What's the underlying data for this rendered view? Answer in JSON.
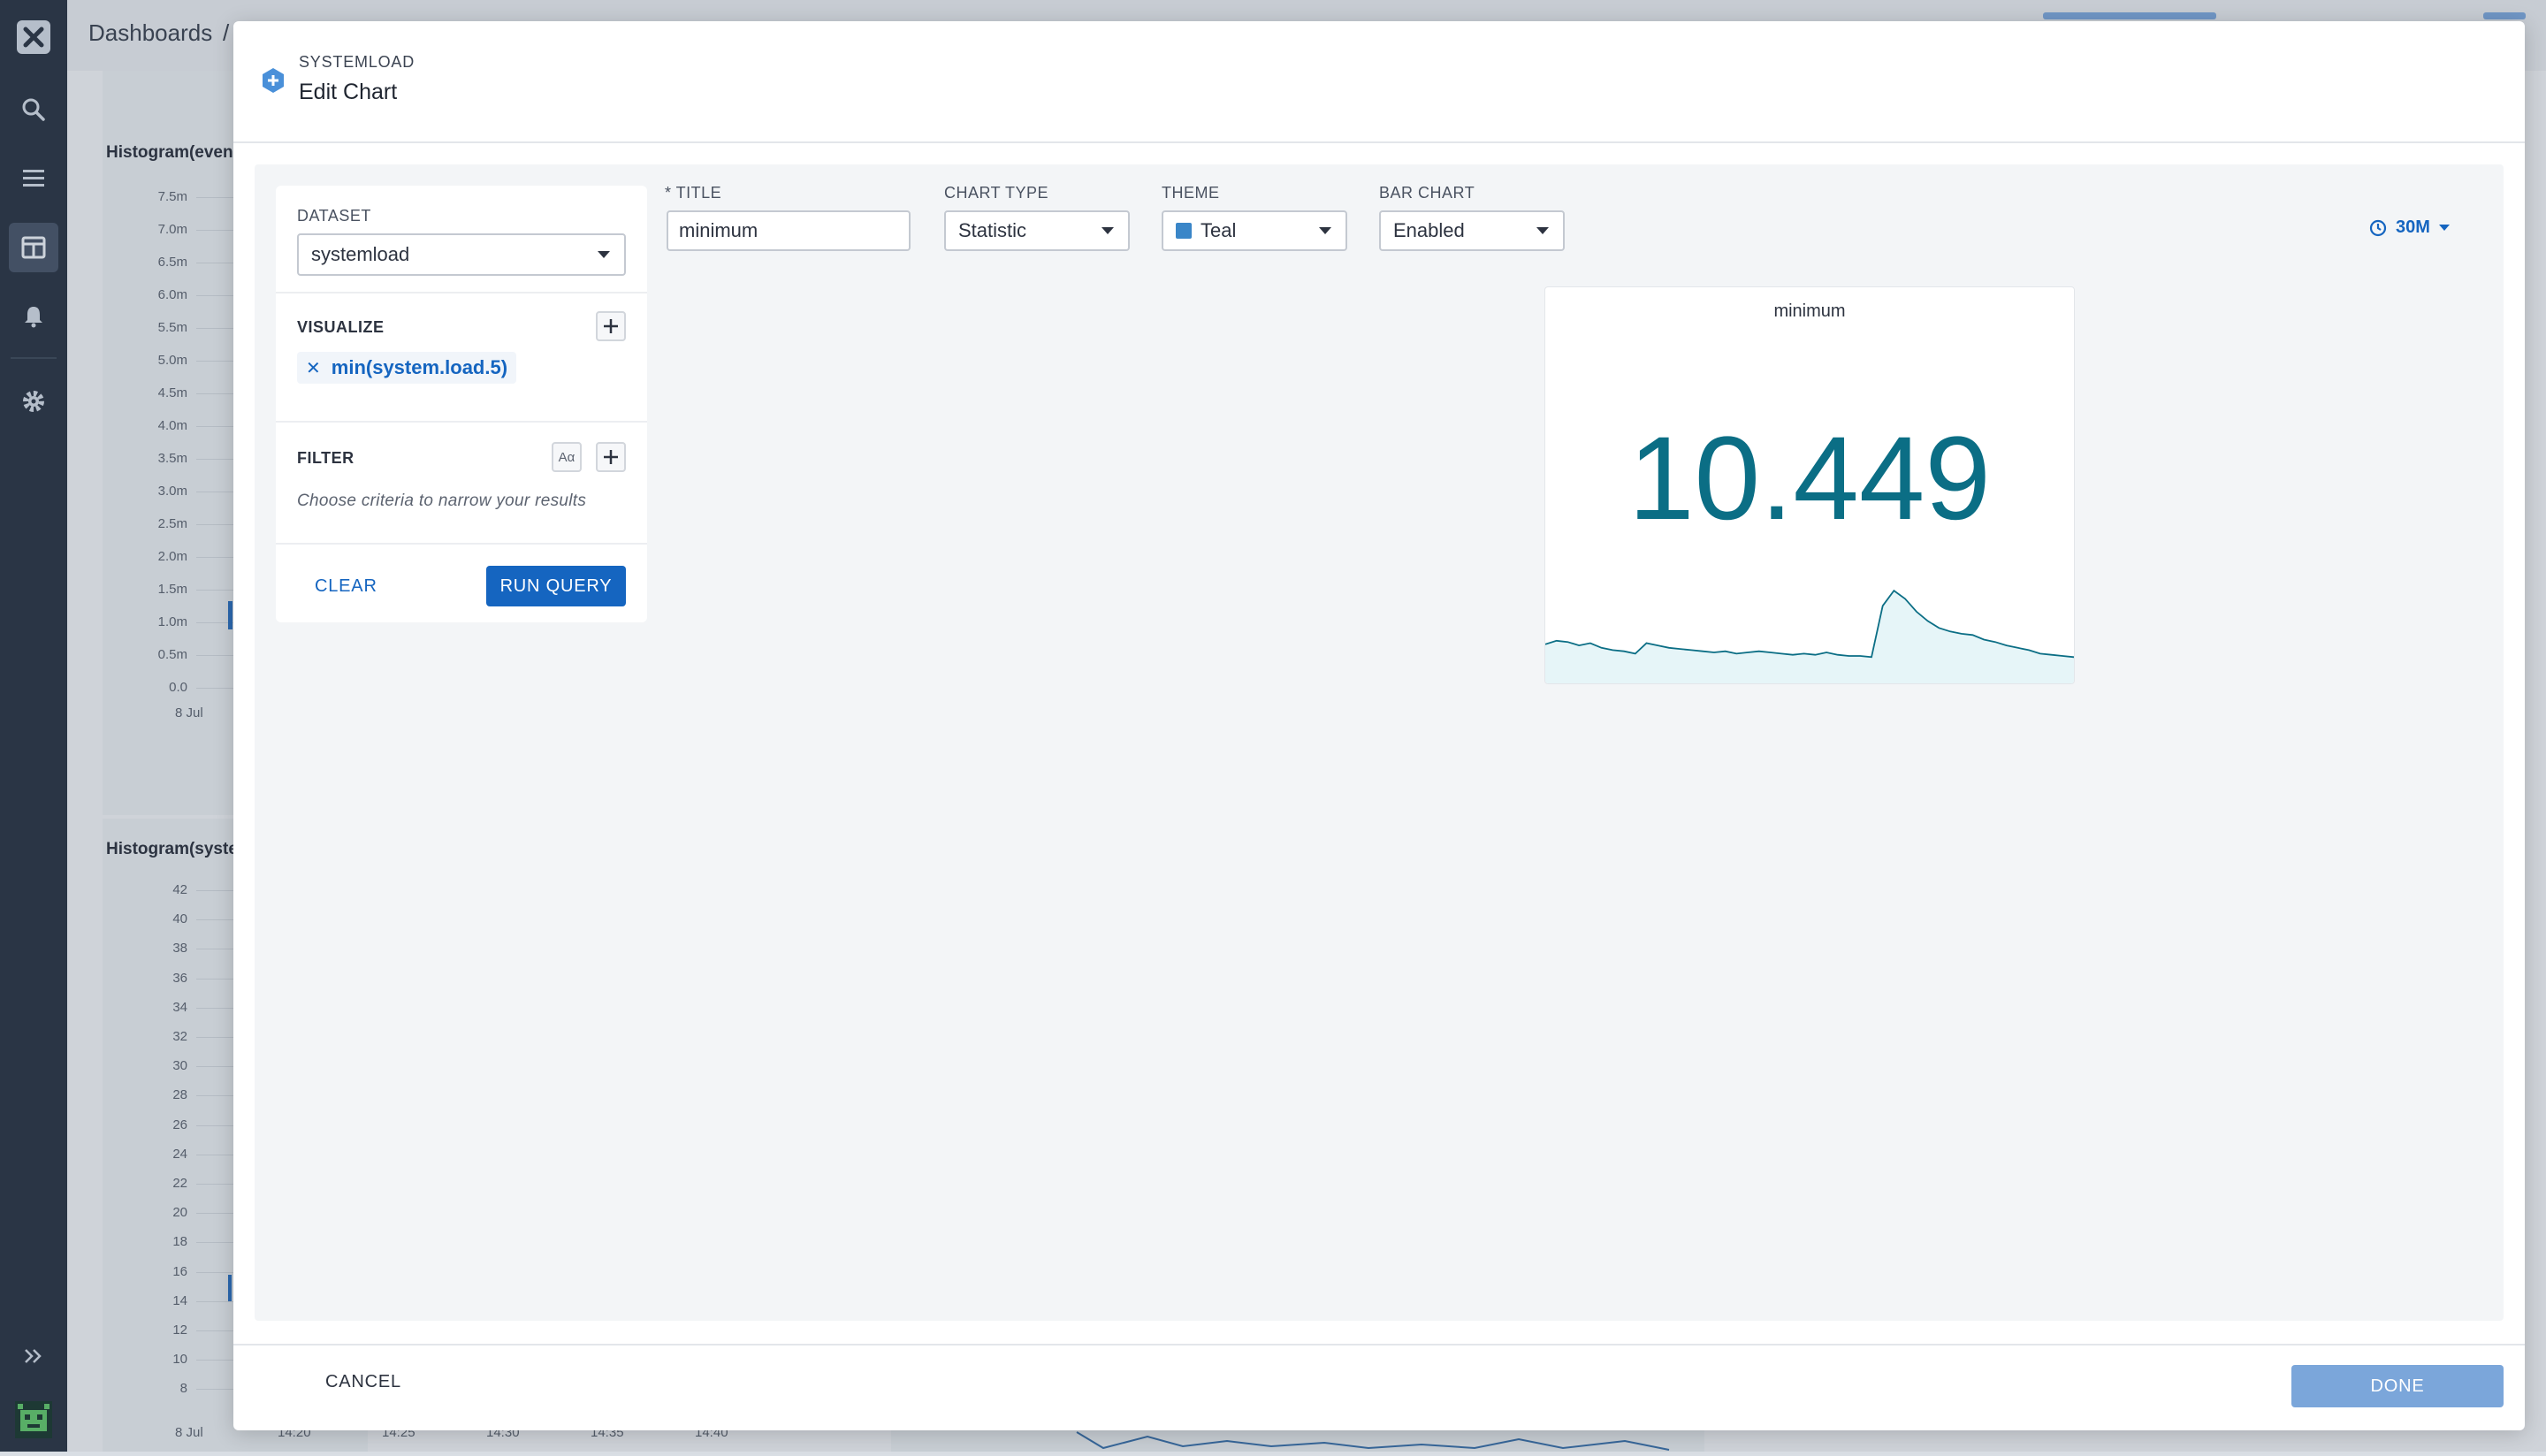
{
  "nav": {
    "items": [
      "logo",
      "search",
      "menu",
      "dashboards",
      "alerts",
      "settings"
    ],
    "expand_icon": "double-chevron-right-icon",
    "avatar_icon": "robot-avatar-icon"
  },
  "background": {
    "breadcrumb": {
      "root": "Dashboards",
      "separator": "/"
    },
    "panel1": {
      "title": "Histogram(even",
      "y_ticks": [
        "7.5m",
        "7.0m",
        "6.5m",
        "6.0m",
        "5.5m",
        "5.0m",
        "4.5m",
        "4.0m",
        "3.5m",
        "3.0m",
        "2.5m",
        "2.0m",
        "1.5m",
        "1.0m",
        "0.5m",
        "0.0"
      ],
      "x_tick": "8 Jul"
    },
    "panel2": {
      "title": "Histogram(syste",
      "y_ticks": [
        "42",
        "40",
        "38",
        "36",
        "34",
        "32",
        "30",
        "28",
        "26",
        "24",
        "22",
        "20",
        "18",
        "16",
        "14",
        "12",
        "10",
        "8"
      ],
      "x_ticks": [
        "8 Jul",
        "14:20",
        "14:25",
        "14:30",
        "14:35",
        "14:40"
      ]
    }
  },
  "modal": {
    "eyebrow": "SYSTEMLOAD",
    "title": "Edit Chart",
    "query": {
      "dataset_label": "DATASET",
      "dataset_value": "systemload",
      "visualize_label": "VISUALIZE",
      "visualize_item": "min(system.load.5)",
      "filter_label": "FILTER",
      "filter_case_toggle": "Aα",
      "filter_placeholder": "Choose criteria to narrow your results",
      "clear_label": "CLEAR",
      "run_label": "RUN QUERY"
    },
    "settings": {
      "title_label": "* TITLE",
      "title_value": "minimum",
      "chart_type_label": "CHART TYPE",
      "chart_type_value": "Statistic",
      "theme_label": "THEME",
      "theme_value": "Teal",
      "theme_color": "#3a86c8",
      "bar_chart_label": "BAR CHART",
      "bar_chart_value": "Enabled",
      "time_range": "30M"
    },
    "stat": {
      "title": "minimum",
      "value": "10.449",
      "color": "#0b6e85",
      "sparkline": [
        3.2,
        3.5,
        3.4,
        3.1,
        3.3,
        2.9,
        2.7,
        2.6,
        2.4,
        3.3,
        3.1,
        2.9,
        2.8,
        2.7,
        2.6,
        2.5,
        2.6,
        2.4,
        2.5,
        2.6,
        2.5,
        2.4,
        2.3,
        2.4,
        2.3,
        2.5,
        2.3,
        2.2,
        2.2,
        2.1,
        6.5,
        7.8,
        7.1,
        6.0,
        5.2,
        4.6,
        4.3,
        4.1,
        4.0,
        3.6,
        3.4,
        3.1,
        2.9,
        2.7,
        2.4,
        2.3,
        2.2,
        2.1
      ]
    },
    "footer": {
      "cancel_label": "CANCEL",
      "done_label": "DONE"
    }
  }
}
